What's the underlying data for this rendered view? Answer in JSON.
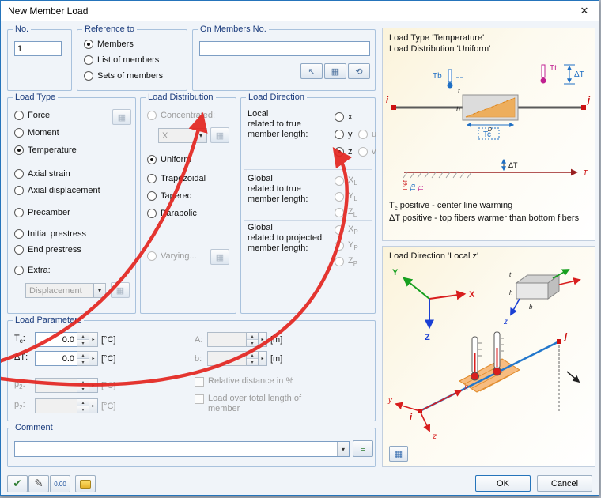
{
  "window": {
    "title": "New Member Load",
    "close_glyph": "✕"
  },
  "no_group": {
    "title": "No.",
    "value": "1"
  },
  "reference_group": {
    "title": "Reference to",
    "options": [
      {
        "label": "Members"
      },
      {
        "label": "List of members"
      },
      {
        "label": "Sets of members"
      }
    ],
    "selected": "Members"
  },
  "on_members_group": {
    "title": "On Members No.",
    "value": ""
  },
  "load_type_group": {
    "title": "Load Type",
    "options": [
      {
        "label": "Force"
      },
      {
        "label": "Moment"
      },
      {
        "label": "Temperature"
      },
      {
        "label": "Axial strain"
      },
      {
        "label": "Axial displacement"
      },
      {
        "label": "Precamber"
      },
      {
        "label": "Initial prestress"
      },
      {
        "label": "End prestress"
      },
      {
        "label": "Extra:"
      }
    ],
    "selected": "Temperature",
    "extra_value": "Displacement"
  },
  "load_distribution_group": {
    "title": "Load Distribution",
    "options": [
      {
        "label": "Concentrated:"
      },
      {
        "label": "Uniform"
      },
      {
        "label": "Trapezoidal"
      },
      {
        "label": "Tapered"
      },
      {
        "label": "Parabolic"
      },
      {
        "label": "Varying..."
      }
    ],
    "selected": "Uniform",
    "concentrated_value": "X"
  },
  "load_direction_group": {
    "title": "Load Direction",
    "local_label": "Local\nrelated to true\nmember length:",
    "global_true_label": "Global\nrelated to true\nmember length:",
    "global_projected_label": "Global\nrelated to projected\nmember length:",
    "local_options": [
      {
        "label": "x"
      },
      {
        "label": "y"
      },
      {
        "label": "z"
      }
    ],
    "local_extra_options": [
      {
        "label": "u"
      },
      {
        "label": "v"
      }
    ],
    "global_true_options": [
      {
        "base": "X",
        "sub": "L"
      },
      {
        "base": "Y",
        "sub": "L"
      },
      {
        "base": "Z",
        "sub": "L"
      }
    ],
    "global_projected_options": [
      {
        "base": "X",
        "sub": "P"
      },
      {
        "base": "Y",
        "sub": "P"
      },
      {
        "base": "Z",
        "sub": "P"
      }
    ],
    "selected": "z"
  },
  "load_parameters_group": {
    "title": "Load Parameters",
    "left_rows": [
      {
        "base": "T",
        "sub": "c",
        "suffix": ":",
        "value": "0.0",
        "unit": "[°C]"
      },
      {
        "base": "ΔT",
        "sub": "",
        "suffix": ":",
        "value": "0.0",
        "unit": "[°C]"
      },
      {
        "base": "p",
        "sub": "2",
        "suffix": ":",
        "value": "",
        "unit": "[°C]"
      },
      {
        "base": "p",
        "sub": "2",
        "suffix": ":",
        "value": "",
        "unit": "[°C]"
      }
    ],
    "right_rows": [
      {
        "label": "A:",
        "value": "",
        "unit": "[m]"
      },
      {
        "label": "b:",
        "value": "",
        "unit": "[m]"
      }
    ],
    "checkbox_relative": "Relative distance in %",
    "checkbox_total_length": "Load over total length of\nmember"
  },
  "comment_group": {
    "title": "Comment",
    "value": ""
  },
  "help_panel": {
    "top": {
      "title_line1": "Load Type 'Temperature'",
      "title_line2": "Load Distribution 'Uniform'",
      "labels": {
        "i": "i",
        "j": "j",
        "t": "t",
        "h": "h",
        "b": "b",
        "tb": "Tb",
        "tt": "Tt",
        "delta_t": "ΔT",
        "tc": "Tc",
        "tref": "Tref",
        "T": "T"
      },
      "note1_base": "T",
      "note1_sub": "c",
      "note1_rest": " positive - center line warming",
      "note2": "ΔT positive - top fibers warmer than bottom fibers"
    },
    "bottom": {
      "title": "Load Direction 'Local z'",
      "labels": {
        "X": "X",
        "Y": "Y",
        "Z": "Z",
        "x": "x",
        "y": "y",
        "z": "z",
        "i": "i",
        "j": "j",
        "t": "t",
        "h": "h",
        "b": "b"
      }
    }
  },
  "footer": {
    "ok": "OK",
    "cancel": "Cancel"
  },
  "icons": {
    "pick_cursor": "↖",
    "pick_table": "▦",
    "pick_lasso": "⟲",
    "dropdown_arrow": "▾",
    "spin_up": "▴",
    "spin_down": "▾",
    "unit_flyout": "▸",
    "edit_options": "▦",
    "comment_templates": "≡",
    "check": "✔",
    "pencil": "✎",
    "calc_display": "0.00",
    "panel_view": "▦"
  },
  "colors": {
    "window_border": "#2574bb",
    "group_title": "#1b3c7d",
    "annotation_arrow": "#e42520",
    "temperature_blue": "#1f6fc4",
    "temperature_magenta": "#c02090",
    "axis_x_red": "#d81e1e",
    "axis_y_green": "#18a020",
    "axis_z_blue": "#1a3fd4"
  }
}
